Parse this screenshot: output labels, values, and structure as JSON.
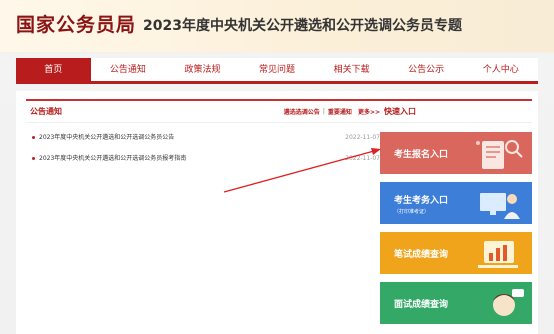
{
  "header": {
    "title": "国家公务员局",
    "subtitle": "2023年度中央机关公开遴选和公开选调公务员专题"
  },
  "nav": {
    "items": [
      "首页",
      "公告通知",
      "政策法规",
      "常见问题",
      "相关下载",
      "公告公示",
      "个人中心"
    ]
  },
  "notices": {
    "title": "公告通知",
    "link_1": "遴选选调公告",
    "separator": "|",
    "link_2": "重要通知",
    "more": "更多>>",
    "items": [
      {
        "text": "2023年度中央机关公开遴选和公开选调公务员公告",
        "date": "2022-11-07"
      },
      {
        "text": "2023年度中央机关公开遴选和公开选调公务员报考指南",
        "date": "2022-11-07"
      }
    ]
  },
  "quick": {
    "title": "快速入口",
    "cards": [
      {
        "label": "考生报名入口",
        "sub": ""
      },
      {
        "label": "考生考务入口",
        "sub": "（打印准考证）"
      },
      {
        "label": "笔试成绩查询",
        "sub": ""
      },
      {
        "label": "面试成绩查询",
        "sub": ""
      }
    ]
  },
  "colors": {
    "brand_red": "#b81c1c",
    "card_register": "#d9675e",
    "card_exam": "#3d7ed8",
    "card_written": "#f0a41c",
    "card_interview": "#34a866",
    "annotation_arrow": "#e02020"
  }
}
